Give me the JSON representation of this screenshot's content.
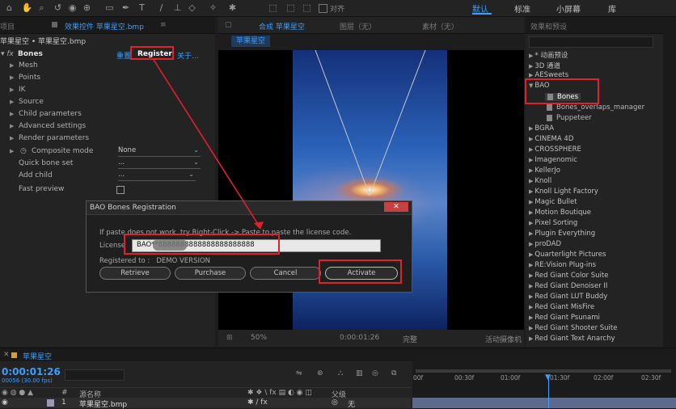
{
  "toolbar": {
    "snap_label": "对齐",
    "workspaces": [
      "默认",
      "标准",
      "小屏幕",
      "库"
    ],
    "active_workspace": "默认"
  },
  "left_panel": {
    "tab_project": "项目",
    "tab_effect_controls": "效果控件 苹果星空.bmp",
    "breadcrumb": "苹果星空 • 苹果星空.bmp",
    "effect_name": "Bones",
    "reset_label": "重置",
    "register_label": "Register",
    "about_label": "关于...",
    "groups": [
      "Mesh",
      "Points",
      "IK",
      "Source",
      "Child parameters",
      "Advanced settings",
      "Render parameters"
    ],
    "composite_mode_label": "Composite mode",
    "composite_mode_value": "None",
    "quick_bone_set_label": "Quick bone set",
    "quick_bone_set_value": "...",
    "add_child_label": "Add child",
    "add_child_value": "...",
    "fast_preview_label": "Fast preview"
  },
  "comp_panel": {
    "tab_label": "合成 苹果星空",
    "tab_layer": "图层（无）",
    "tab_footage": "素材（无）",
    "comp_button": "苹果星空",
    "zoom": "50%",
    "timecode": "0:00:01:26",
    "quality": "完整",
    "active_camera": "活动摄像机"
  },
  "dialog": {
    "title": "BAO Bones Registration",
    "hint": "If paste does not work, try Right-Click -> Paste to paste the license code.",
    "license_label": "License",
    "license_value": "BAO**8888888888888888888888",
    "registered_to": "Registered to :   DEMO VERSION",
    "buttons": {
      "retrieve": "Retrieve",
      "purchase": "Purchase",
      "cancel": "Cancel",
      "activate": "Activate"
    }
  },
  "effects_panel": {
    "title": "效果和预设",
    "items": [
      {
        "label": "* 动画预设",
        "open": false
      },
      {
        "label": "3D 通道",
        "open": false
      },
      {
        "label": "AESweets",
        "open": false
      },
      {
        "label": "BAO",
        "open": true
      }
    ],
    "bao_children": [
      "Bones",
      "Bones_overlaps_manager",
      "Puppeteer"
    ],
    "more_items": [
      "BGRA",
      "CINEMA 4D",
      "CROSSPHERE",
      "Imagenomic",
      "KellerJo",
      "Knoll",
      "Knoll Light Factory",
      "Magic Bullet",
      "Motion Boutique",
      "Pixel Sorting",
      "Plugin Everything",
      "proDAD",
      "Quarterlight Pictures",
      "RE:Vision Plug-ins",
      "Red Giant Color Suite",
      "Red Giant Denoiser II",
      "Red Giant LUT Buddy",
      "Red Giant MisFire",
      "Red Giant Psunami",
      "Red Giant Shooter Suite",
      "Red Giant Text Anarchy"
    ]
  },
  "timeline": {
    "tab_label": "苹果星空",
    "timecode": "0:00:01:26",
    "frames": "00056 (30.00 fps)",
    "col_number": "#",
    "col_source": "源名称",
    "col_parent": "父级",
    "layer_number": "1",
    "layer_name": "苹果星空.bmp",
    "layer_parent": "无",
    "ruler": [
      "00f",
      "00:30f",
      "01:00f",
      "01:30f",
      "02:00f",
      "02:30f"
    ]
  }
}
